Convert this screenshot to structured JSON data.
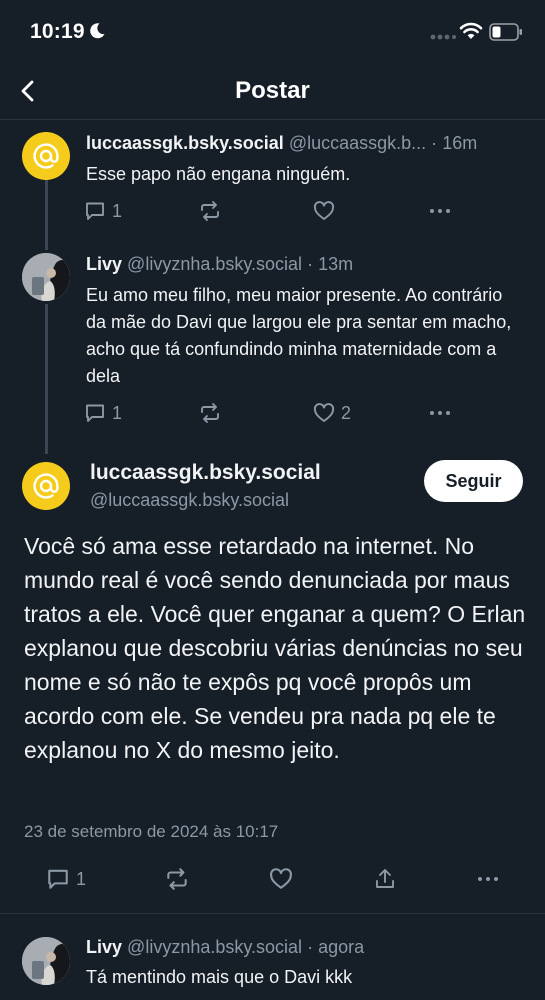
{
  "status_bar": {
    "time": "10:19",
    "icons": [
      "moon-icon",
      "cellular-signal-icon",
      "wifi-icon",
      "battery-icon"
    ]
  },
  "nav": {
    "title": "Postar",
    "back_icon": "chevron-left-icon"
  },
  "colors": {
    "background": "#161e27",
    "text": "#f1f3f5",
    "muted": "#8b98a5",
    "avatar_yellow": "#f5cc1b",
    "divider": "#2a3440"
  },
  "thread": [
    {
      "display_name": "luccaassgk.bsky.social",
      "handle": "@luccaassgk.b...",
      "separator": "·",
      "time": "16m",
      "text": "Esse papo não engana ninguém.",
      "avatar": "at-sign-avatar",
      "reply_count": "1",
      "repost_count": "",
      "like_count": ""
    },
    {
      "display_name": "Livy",
      "handle": "@livyznha.bsky.social",
      "separator": "·",
      "time": "13m",
      "text": "Eu amo meu filho, meu maior presente. Ao contrário da mãe do Davi que largou ele pra sentar em macho, acho que tá confundindo minha maternidade com a dela",
      "avatar": "photo-avatar",
      "reply_count": "1",
      "repost_count": "",
      "like_count": "2"
    }
  ],
  "main_post": {
    "display_name": "luccaassgk.bsky.social",
    "handle": "@luccaassgk.bsky.social",
    "follow_label": "Seguir",
    "text": "Você só ama esse retardado na internet. No mundo real é você sendo denunciada por maus tratos a ele. Você quer enganar a quem? O Erlan explanou que descobriu várias denúncias no seu nome e só não te expôs pq você propôs um acordo com ele. Se vendeu pra nada pq ele te explanou no X do mesmo jeito.",
    "date": "23 de setembro de 2024 às 10:17",
    "reply_count": "1"
  },
  "reply": {
    "display_name": "Livy",
    "handle": "@livyznha.bsky.social",
    "separator": "·",
    "time": "agora",
    "text": "Tá mentindo mais que o Davi kkk"
  }
}
